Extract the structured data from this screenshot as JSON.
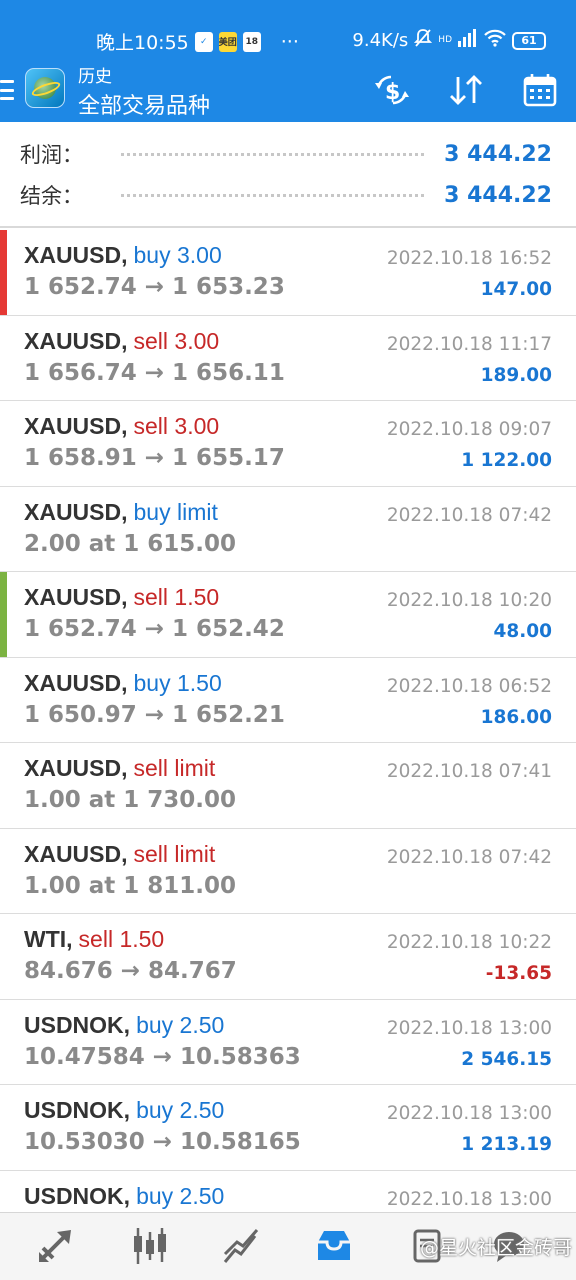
{
  "status_bar": {
    "time": "晚上10:55",
    "icon_label_1": "美团",
    "icon_label_2": "18",
    "more": "···",
    "speed": "9.4K/s",
    "network": "HD",
    "battery": "61"
  },
  "appbar": {
    "title_small": "历史",
    "title_big": "全部交易品种",
    "icons": [
      "currency-exchange-icon",
      "sort-icon",
      "calendar-icon"
    ]
  },
  "summary": {
    "profit_label": "利润：",
    "profit_value": "3 444.22",
    "balance_label": "结余：",
    "balance_value": "3 444.22"
  },
  "colors": {
    "primary": "#1e88e5",
    "buy": "#1976d2",
    "sell": "#c62828",
    "marker_red": "#e53935",
    "marker_green": "#7cb342"
  },
  "trades": [
    {
      "symbol": "XAUUSD,",
      "direction": "buy 3.00",
      "type": "buy",
      "prices": "1 652.74 → 1 653.23",
      "time": "2022.10.18 16:52",
      "profit": "147.00",
      "marker": "red"
    },
    {
      "symbol": "XAUUSD,",
      "direction": "sell 3.00",
      "type": "sell",
      "prices": "1 656.74 → 1 656.11",
      "time": "2022.10.18 11:17",
      "profit": "189.00",
      "marker": ""
    },
    {
      "symbol": "XAUUSD,",
      "direction": "sell 3.00",
      "type": "sell",
      "prices": "1 658.91 → 1 655.17",
      "time": "2022.10.18 09:07",
      "profit": "1 122.00",
      "marker": ""
    },
    {
      "symbol": "XAUUSD,",
      "direction": "buy limit",
      "type": "buy",
      "prices": "2.00 at 1 615.00",
      "time": "2022.10.18 07:42",
      "profit": "",
      "marker": ""
    },
    {
      "symbol": "XAUUSD,",
      "direction": "sell 1.50",
      "type": "sell",
      "prices": "1 652.74 → 1 652.42",
      "time": "2022.10.18 10:20",
      "profit": "48.00",
      "marker": "green"
    },
    {
      "symbol": "XAUUSD,",
      "direction": "buy 1.50",
      "type": "buy",
      "prices": "1 650.97 → 1 652.21",
      "time": "2022.10.18 06:52",
      "profit": "186.00",
      "marker": ""
    },
    {
      "symbol": "XAUUSD,",
      "direction": "sell limit",
      "type": "sell",
      "prices": "1.00 at 1 730.00",
      "time": "2022.10.18 07:41",
      "profit": "",
      "marker": ""
    },
    {
      "symbol": "XAUUSD,",
      "direction": "sell limit",
      "type": "sell",
      "prices": "1.00 at 1 811.00",
      "time": "2022.10.18 07:42",
      "profit": "",
      "marker": ""
    },
    {
      "symbol": "WTI,",
      "direction": "sell 1.50",
      "type": "sell",
      "prices": "84.676 → 84.767",
      "time": "2022.10.18 10:22",
      "profit": "-13.65",
      "marker": ""
    },
    {
      "symbol": "USDNOK,",
      "direction": "buy 2.50",
      "type": "buy",
      "prices": "10.47584 → 10.58363",
      "time": "2022.10.18 13:00",
      "profit": "2 546.15",
      "marker": ""
    },
    {
      "symbol": "USDNOK,",
      "direction": "buy 2.50",
      "type": "buy",
      "prices": "10.53030 → 10.58165",
      "time": "2022.10.18 13:00",
      "profit": "1 213.19",
      "marker": ""
    },
    {
      "symbol": "USDNOK,",
      "direction": "buy 2.50",
      "type": "buy",
      "prices": "",
      "time": "2022.10.18 13:00",
      "profit": "",
      "marker": ""
    }
  ],
  "bottom_nav": {
    "items": [
      "quotes-icon",
      "chart-icon",
      "trade-icon",
      "history-icon",
      "messages-icon"
    ],
    "active": "history-icon",
    "watermark": "@星火社区金砖哥"
  }
}
